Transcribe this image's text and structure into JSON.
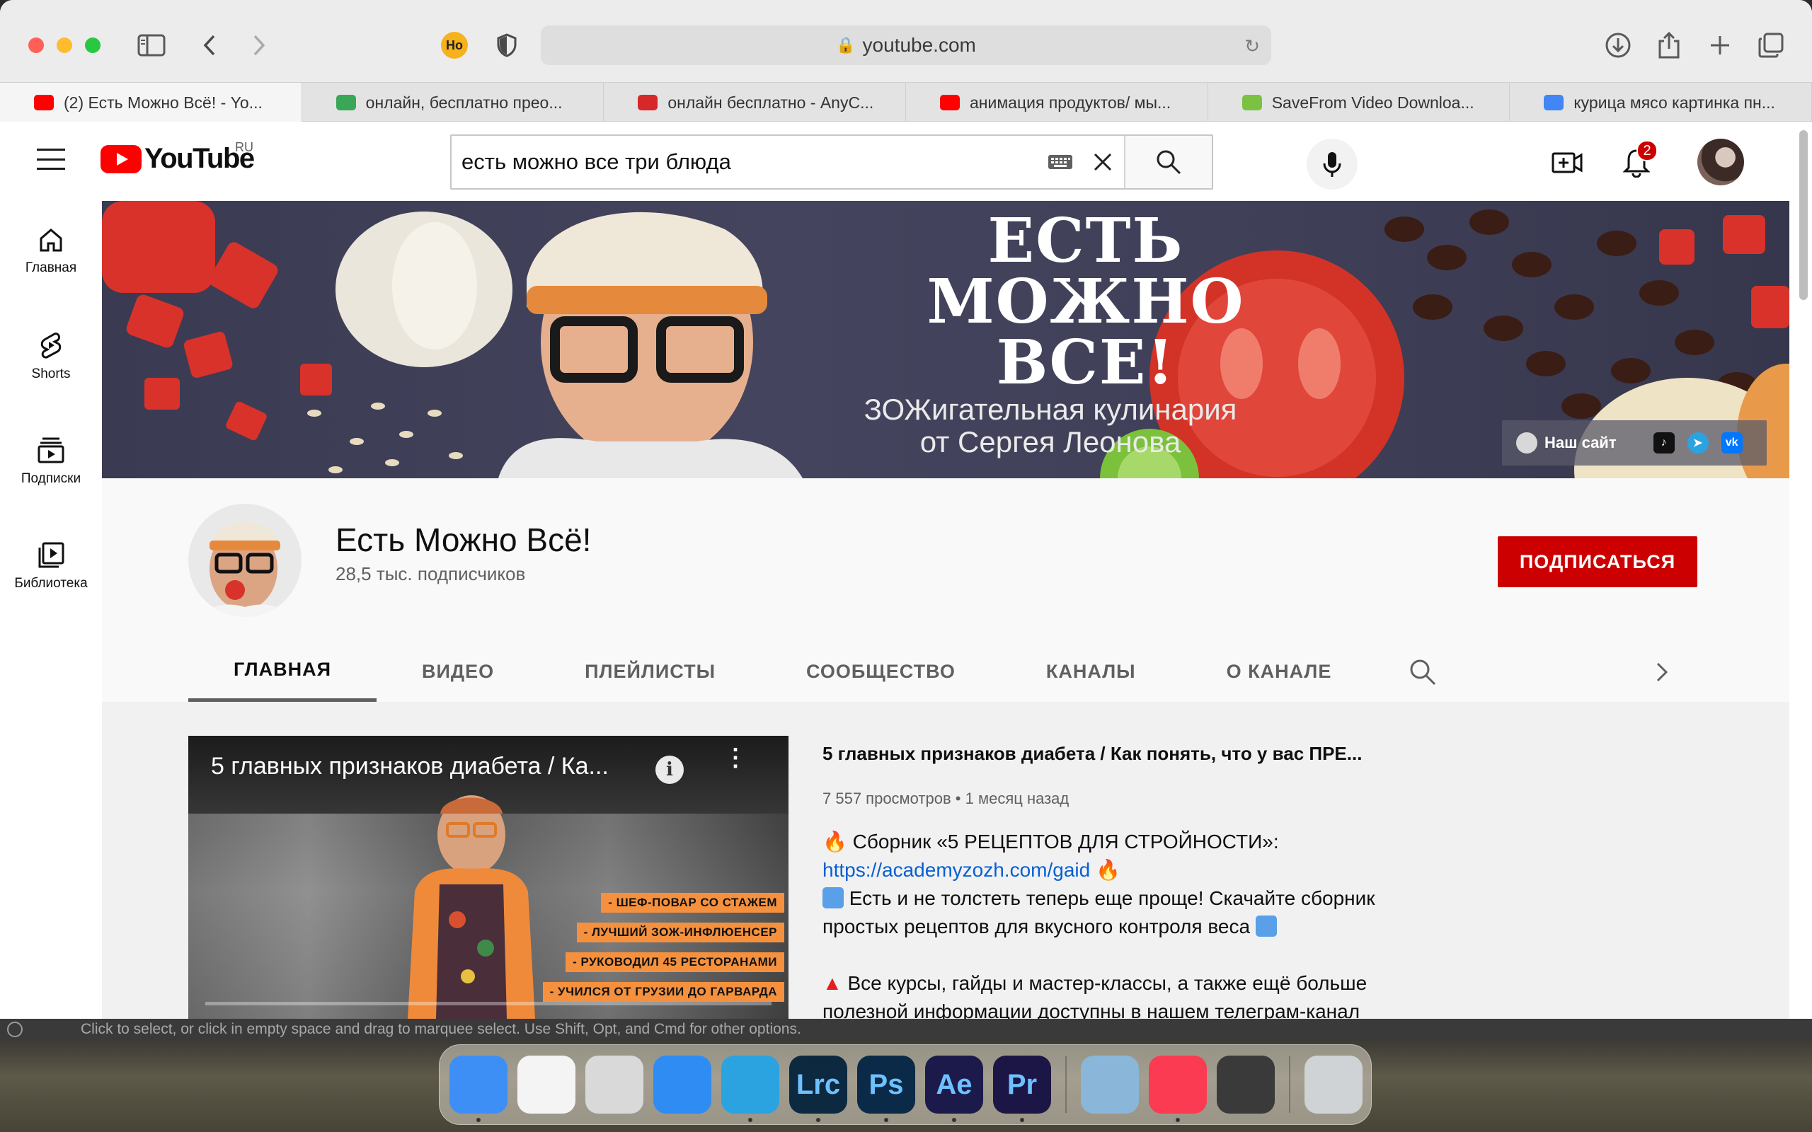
{
  "browser": {
    "url": "youtube.com",
    "tabs": [
      {
        "title": "(2) Есть Можно Всё! - Yo...",
        "favicon": "youtube-icon",
        "color": "#ff0000"
      },
      {
        "title": "онлайн, бесплатно прео...",
        "favicon": "convert-icon",
        "color": "#3aa757"
      },
      {
        "title": "онлайн бесплатно - AnyC...",
        "favicon": "anyconv-icon",
        "color": "#d62828"
      },
      {
        "title": "анимация продуктов/ мы...",
        "favicon": "youtube-icon",
        "color": "#ff0000"
      },
      {
        "title": "SaveFrom Video Downloa...",
        "favicon": "download-icon",
        "color": "#7cc242"
      },
      {
        "title": "курица мясо картинка пн...",
        "favicon": "google-icon",
        "color": "#4285f4"
      }
    ],
    "extension_badge": "Ho"
  },
  "youtube": {
    "logo_text": "YouTube",
    "region": "RU",
    "search_value": "есть можно все три блюда",
    "notifications_count": "2",
    "sidebar": [
      {
        "label": "Главная",
        "icon": "home-icon"
      },
      {
        "label": "Shorts",
        "icon": "shorts-icon"
      },
      {
        "label": "Подписки",
        "icon": "subscriptions-icon"
      },
      {
        "label": "Библиотека",
        "icon": "library-icon"
      }
    ]
  },
  "banner": {
    "title_line1": "ЕСТЬ",
    "title_line2": "МОЖНО",
    "title_line3": "ВСЕ!",
    "subtitle_line1": "ЗОЖигательная кулинария",
    "subtitle_line2": "от Сергея Леонова",
    "site_link": "Наш сайт"
  },
  "channel": {
    "name": "Есть Можно Всё!",
    "subscribers": "28,5 тыс. подписчиков",
    "subscribe_label": "ПОДПИСАТЬСЯ",
    "tabs": [
      "ГЛАВНАЯ",
      "ВИДЕО",
      "ПЛЕЙЛИСТЫ",
      "СООБЩЕСТВО",
      "КАНАЛЫ",
      "О КАНАЛЕ"
    ],
    "active_tab": "ГЛАВНАЯ"
  },
  "featured_video": {
    "thumb_title": "5 главных признаков диабета / Ка...",
    "title": "5 главных признаков диабета / Как понять, что у вас ПРЕ...",
    "views": "7 557 просмотров",
    "age": "1 месяц назад",
    "badges": [
      "- ШЕФ-ПОВАР СО СТАЖЕМ",
      "- ЛУЧШИЙ ЗОЖ-ИНФЛЮЕНСЕР",
      "- РУКОВОДИЛ 45 РЕСТОРАНАМИ",
      "- УЧИЛСЯ ОТ ГРУЗИИ ДО ГАРВАРДА"
    ],
    "desc_line1": " Сборник «5 РЕЦЕПТОВ ДЛЯ СТРОЙНОСТИ»:",
    "desc_link": "https://academyzozh.com/gaid",
    "desc_line3": " Есть и не толстеть теперь еще проще! Скачайте сборник",
    "desc_line4": "простых рецептов для вкусного контроля веса ",
    "desc_line5": " Все курсы, гайды и мастер-классы, а также ещё больше",
    "desc_line6": "полезной информации доступны в нашем телеграм-канал"
  },
  "status_bar": {
    "text": "Click to select, or click in empty space and drag to marquee select. Use Shift, Opt, and Cmd for other options."
  },
  "dock": {
    "apps": [
      {
        "name": "finder",
        "label": "",
        "color": "#3d8ff5"
      },
      {
        "name": "photos",
        "label": "",
        "color": "#f4f4f4"
      },
      {
        "name": "launchpad",
        "label": "",
        "color": "#d9d9d9"
      },
      {
        "name": "safari",
        "label": "",
        "color": "#2f8cf3"
      },
      {
        "name": "telegram",
        "label": "",
        "color": "#2aa3e0"
      },
      {
        "name": "lightroom",
        "label": "Lrc",
        "color": "#0c2940"
      },
      {
        "name": "photoshop",
        "label": "Ps",
        "color": "#0b2a47"
      },
      {
        "name": "after-effects",
        "label": "Ae",
        "color": "#1b1a4a"
      },
      {
        "name": "premiere",
        "label": "Pr",
        "color": "#1c1646"
      },
      {
        "name": "preview",
        "label": "",
        "color": "#8ab6d9"
      },
      {
        "name": "music",
        "label": "",
        "color": "#fa3b52"
      },
      {
        "name": "quicktime",
        "label": "",
        "color": "#3a3a3a"
      },
      {
        "name": "trash",
        "label": "",
        "color": "#cfd3d6"
      }
    ]
  }
}
